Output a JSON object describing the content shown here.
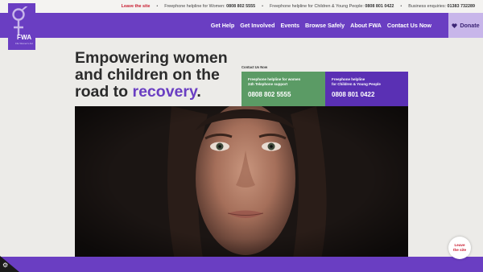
{
  "topbar": {
    "leave_label": "Leave the site",
    "women_helpline_label": "Freephone helpline for Women:",
    "women_helpline_number": "0808 802 5555",
    "children_helpline_label": "Freephone helpline for Children & Young People:",
    "children_helpline_number": "0808 801 0422",
    "business_label": "Business enquiries:",
    "business_number": "01383 732289",
    "separator": "•"
  },
  "logo": {
    "text": "FWA",
    "subtext": "Fife Women's Aid"
  },
  "nav": {
    "items": [
      {
        "label": "Get Help"
      },
      {
        "label": "Get Involved"
      },
      {
        "label": "Events"
      },
      {
        "label": "Browse Safely"
      },
      {
        "label": "About FWA"
      },
      {
        "label": "Contact Us Now"
      }
    ],
    "donate_label": "Donate",
    "donate_icon": "heart-icon"
  },
  "hero": {
    "title_part1": "Empowering women and children on the road to ",
    "title_accent": "recovery",
    "title_end": "."
  },
  "contact": {
    "label": "Contact Us Now",
    "women_box": {
      "line1": "Freephone helpline for women",
      "line2": "24h Telephone support",
      "number": "0808 802 5555"
    },
    "children_box": {
      "line1": "Freephone helpline",
      "line2": "for Children & Young People",
      "number": "0808 801 0422"
    }
  },
  "floating": {
    "leave_line1": "Leave",
    "leave_line2": "the site",
    "cookie_icon": "gear-icon"
  },
  "colors": {
    "brand_purple": "#6a3ec2",
    "green": "#5b9b65",
    "leave_red": "#c81a2e",
    "donate_bg": "#c8b6ea"
  }
}
